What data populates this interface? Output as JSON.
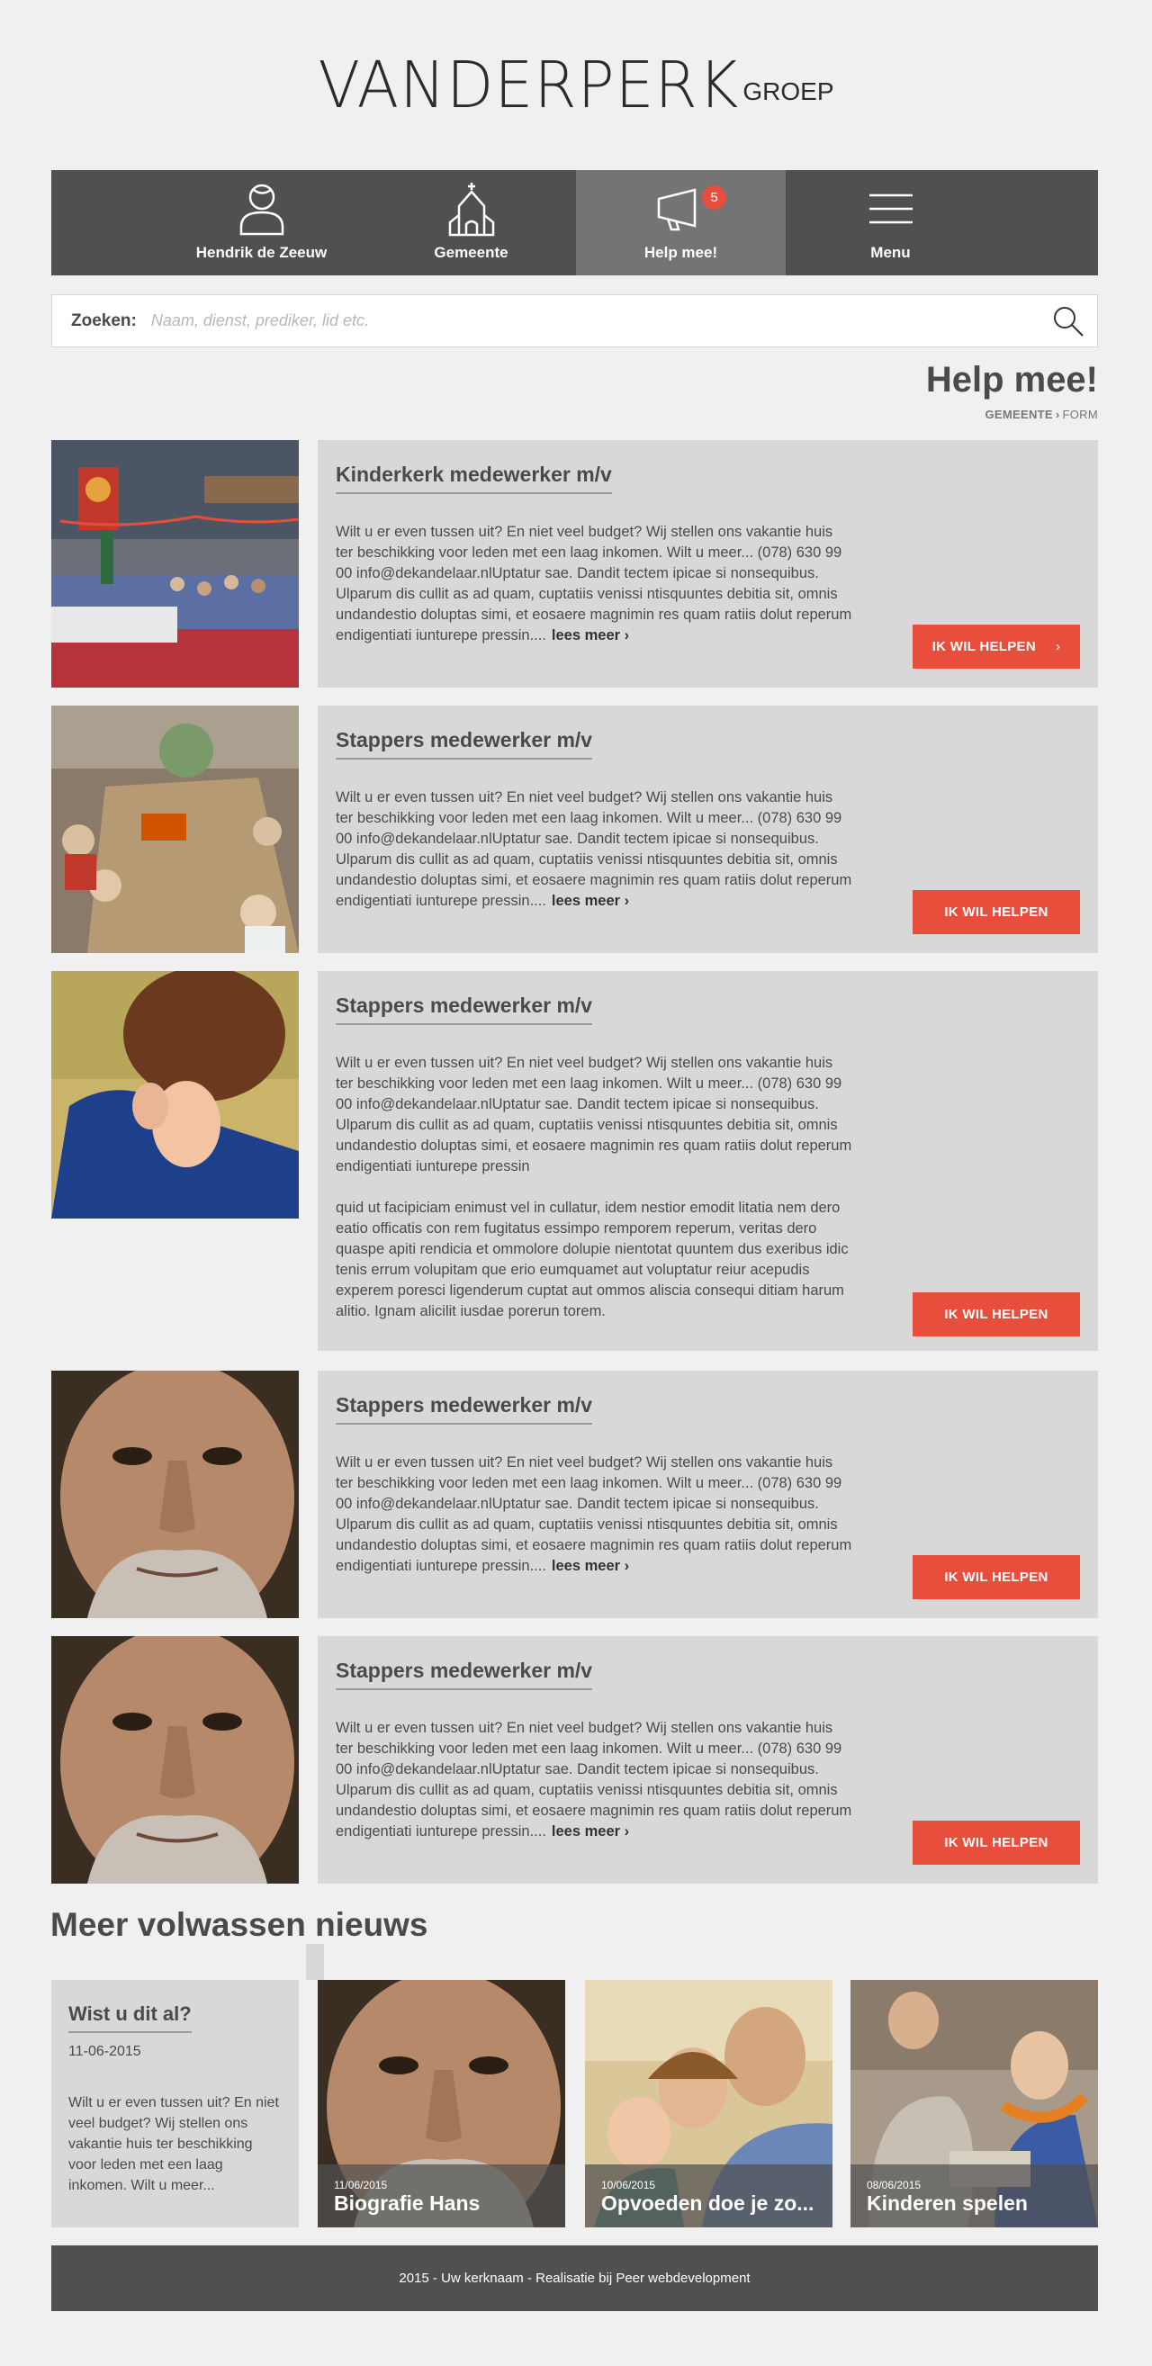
{
  "logo": {
    "main": "VANDERPERK",
    "sub": "GROEP"
  },
  "nav": {
    "items": [
      {
        "label": "Hendrik de Zeeuw",
        "icon": "user-icon"
      },
      {
        "label": "Gemeente",
        "icon": "church-icon"
      },
      {
        "label": "Help mee!",
        "icon": "megaphone-icon",
        "badge": "5"
      },
      {
        "label": "Menu",
        "icon": "hamburger-icon"
      }
    ]
  },
  "search": {
    "label": "Zoeken:",
    "placeholder": "Naam, dienst, prediker, lid etc."
  },
  "page": {
    "title": "Help mee!",
    "breadcrumb": [
      "GEMEENTE",
      "FORM"
    ]
  },
  "cards": [
    {
      "title": "Kinderkerk medewerker  m/v",
      "text": "Wilt u er even tussen uit? En niet veel budget? Wij stellen ons vakantie huis ter beschikking voor leden met een laag inkomen. Wilt u meer... (078) 630 99 00 info@dekandelaar.nlUptatur sae. Dandit tectem ipicae si nonsequibus. Ulparum dis cullit as ad quam, cuptatiis venissi ntisquuntes debitia sit, omnis undandestio doluptas simi, et eosaere magnimin res quam ratiis dolut reperum endigentiati iunturepe pressin....",
      "more": "lees meer",
      "button": "IK WIL HELPEN",
      "image": "children-church-hall-photo"
    },
    {
      "title": "Stappers medewerker  m/v",
      "text": "Wilt u er even tussen uit? En niet veel budget? Wij stellen ons vakantie huis ter beschikking voor leden met een laag inkomen. Wilt u meer... (078) 630 99 00 info@dekandelaar.nlUptatur sae. Dandit tectem ipicae si nonsequibus. Ulparum dis cullit as ad quam, cuptatiis venissi ntisquuntes debitia sit, omnis undandestio doluptas simi, et eosaere magnimin res quam ratiis dolut reperum endigentiati iunturepe pressin....",
      "more": "lees meer",
      "button": "IK WIL HELPEN",
      "image": "children-crafts-table-photo"
    },
    {
      "title": "Stappers medewerker  m/v",
      "text": "Wilt u er even tussen uit? En niet veel budget? Wij stellen ons vakantie huis ter beschikking voor leden met een laag inkomen. Wilt u meer... (078) 630 99 00 info@dekandelaar.nlUptatur sae. Dandit tectem ipicae si nonsequibus. Ulparum dis cullit as ad quam, cuptatiis venissi ntisquuntes debitia sit, omnis undandestio doluptas simi, et eosaere magnimin res quam ratiis dolut reperum endigentiati iunturepe pressin",
      "text2": "quid ut facipiciam enimust vel in cullatur, idem nestior emodit litatia nem dero eatio officatis con rem fugitatus essimpo remporem reperum, veritas dero quaspe apiti rendicia et ommolore dolupie nientotat quuntem dus exeribus idic tenis errum volupitam que erio eumquamet aut voluptatur reiur acepudis experem poresci ligenderum cuptat aut ommos aliscia consequi ditiam harum alitio. Ignam alicilit iusdae porerun torem.",
      "button": "IK WIL HELPEN",
      "image": "praying-boy-photo"
    },
    {
      "title": "Stappers medewerker  m/v",
      "text": "Wilt u er even tussen uit? En niet veel budget? Wij stellen ons vakantie huis ter beschikking voor leden met een laag inkomen. Wilt u meer... (078) 630 99 00 info@dekandelaar.nlUptatur sae. Dandit tectem ipicae si nonsequibus. Ulparum dis cullit as ad quam, cuptatiis venissi ntisquuntes debitia sit, omnis undandestio doluptas simi, et eosaere magnimin res quam ratiis dolut reperum endigentiati iunturepe pressin....",
      "more": "lees meer",
      "button": "IK WIL HELPEN",
      "image": "older-man-portrait-photo"
    },
    {
      "title": "Stappers medewerker  m/v",
      "text": "Wilt u er even tussen uit? En niet veel budget? Wij stellen ons vakantie huis ter beschikking voor leden met een laag inkomen. Wilt u meer... (078) 630 99 00 info@dekandelaar.nlUptatur sae. Dandit tectem ipicae si nonsequibus. Ulparum dis cullit as ad quam, cuptatiis venissi ntisquuntes debitia sit, omnis undandestio doluptas simi, et eosaere magnimin res quam ratiis dolut reperum endigentiati iunturepe pressin....",
      "more": "lees meer",
      "button": "IK WIL HELPEN",
      "image": "older-man-portrait-photo"
    }
  ],
  "news": {
    "heading": "Meer volwassen nieuws",
    "feature": {
      "title": "Wist u dit al?",
      "date": "11-06-2015",
      "text": "Wilt u er even tussen uit? En niet veel budget? Wij stellen ons vakantie huis ter beschikking voor leden met een laag inkomen. Wilt u meer..."
    },
    "items": [
      {
        "date": "11/06/2015",
        "title": "Biografie Hans",
        "image": "older-man-portrait-photo"
      },
      {
        "date": "10/06/2015",
        "title": "Opvoeden doe je zo...",
        "image": "family-laughing-photo"
      },
      {
        "date": "08/06/2015",
        "title": "Kinderen spelen",
        "image": "children-playing-photo"
      }
    ]
  },
  "footer": {
    "text": "2015 - Uw kerknaam - Realisatie bij Peer webdevelopment"
  },
  "colors": {
    "accent": "#e84e3c",
    "nav": "#505050",
    "nav_active": "#747474",
    "panel": "#d8d8d8",
    "logo_slash": "#2a6ebb"
  }
}
